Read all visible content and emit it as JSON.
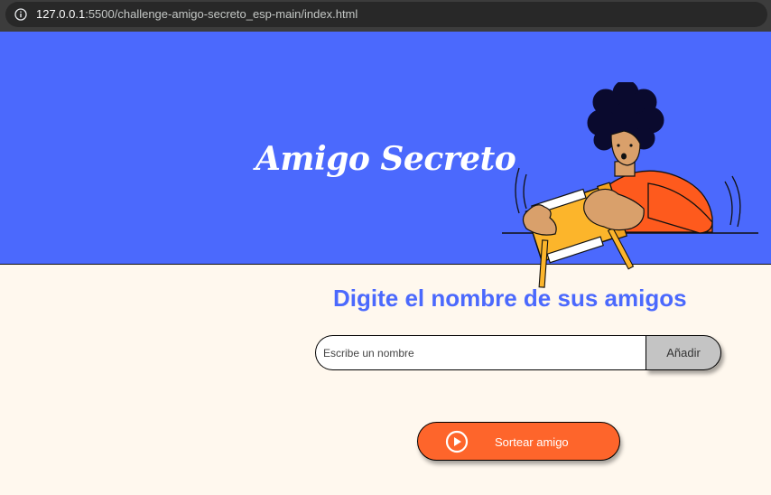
{
  "browser": {
    "url_host": "127.0.0.1",
    "url_path": ":5500/challenge-amigo-secreto_esp-main/index.html",
    "info_icon": "info-circle-icon"
  },
  "banner": {
    "title": "Amigo Secreto",
    "image": "person-holding-box-illustration"
  },
  "main": {
    "title": "Digite el nombre de sus amigos",
    "name_input": {
      "placeholder": "Escribe un nombre",
      "value": ""
    },
    "add_button": "Añadir",
    "draw_button": {
      "label": "Sortear amigo",
      "icon": "play-circle-icon"
    }
  },
  "colors": {
    "banner_bg": "#4b69fd",
    "page_bg": "#fff8ee",
    "accent_orange": "#fe652b",
    "title_blue": "#4b69fd",
    "add_button_bg": "#c4c4c4"
  }
}
